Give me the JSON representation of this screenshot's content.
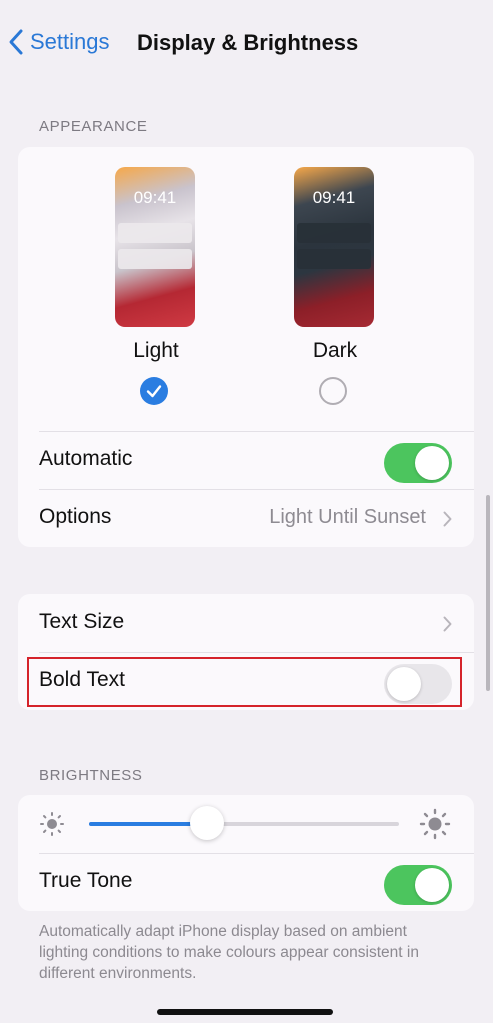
{
  "nav": {
    "back_label": "Settings",
    "title": "Display & Brightness",
    "back_icon": "chevron-left-icon"
  },
  "appearance": {
    "section_label": "APPEARANCE",
    "themes": [
      {
        "label": "Light",
        "clock": "09:41",
        "selected": true
      },
      {
        "label": "Dark",
        "clock": "09:41",
        "selected": false
      }
    ],
    "automatic": {
      "label": "Automatic",
      "on": true
    },
    "options": {
      "label": "Options",
      "value": "Light Until Sunset"
    }
  },
  "text": {
    "text_size": {
      "label": "Text Size"
    },
    "bold_text": {
      "label": "Bold Text",
      "on": false
    }
  },
  "brightness": {
    "section_label": "BRIGHTNESS",
    "level": 0.38,
    "true_tone": {
      "label": "True Tone",
      "on": true
    },
    "footnote": "Automatically adapt iPhone display based on ambient lighting conditions to make colours appear consistent in different environments."
  },
  "colors": {
    "accent": "#2a7de1",
    "toggle_on": "#4cc55e",
    "highlight_box": "#d5232b",
    "background": "#f2eff4"
  }
}
